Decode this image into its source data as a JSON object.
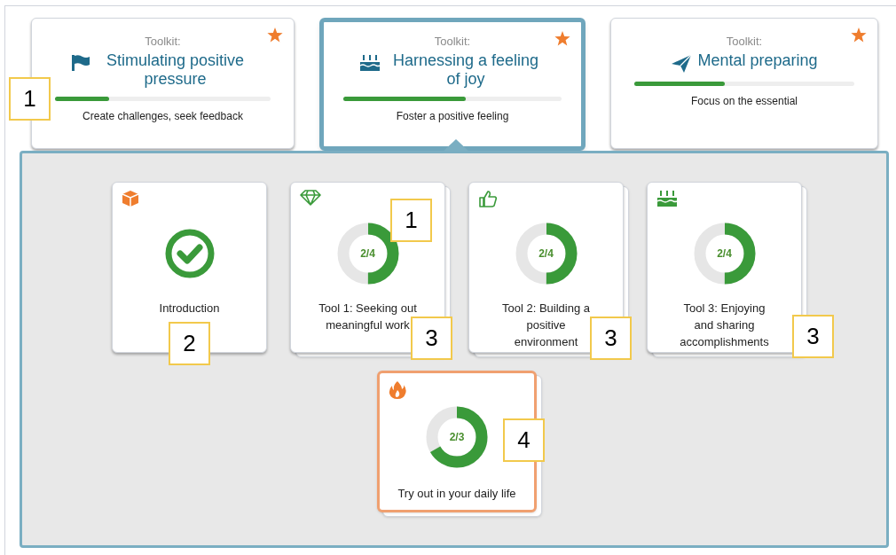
{
  "toolkits": [
    {
      "label": "Toolkit:",
      "title": "Stimulating positive pressure",
      "level": 0.25,
      "description": "Create challenges, seek feedback",
      "selected": false
    },
    {
      "label": "Toolkit:",
      "title": "Harnessing a feeling of joy",
      "level": 0.56,
      "description": "Foster a positive feeling",
      "selected": true
    },
    {
      "label": "Toolkit:",
      "title": "Mental preparing",
      "level": 0.41,
      "description": "Focus on the essential",
      "selected": false
    }
  ],
  "tools": [
    {
      "kind": "complete",
      "title": "Introduction",
      "stacked": false,
      "highlighted": false
    },
    {
      "kind": "progress",
      "title": "Tool 1: Seeking out meaningful work",
      "progress": "2/4",
      "level": 0.5,
      "stacked": true,
      "highlighted": false
    },
    {
      "kind": "progress",
      "title": "Tool 2: Building a positive environment",
      "progress": "2/4",
      "level": 0.5,
      "stacked": true,
      "highlighted": false
    },
    {
      "kind": "progress",
      "title": "Tool 3: Enjoying and sharing accomplishments",
      "progress": "2/4",
      "level": 0.5,
      "stacked": true,
      "highlighted": false
    },
    {
      "kind": "progress",
      "title": "Try out in your daily life",
      "progress": "2/3",
      "level": 0.667,
      "stacked": true,
      "highlighted": true
    }
  ],
  "callouts": [
    {
      "text": "1"
    },
    {
      "text": "1"
    },
    {
      "text": "2"
    },
    {
      "text": "3"
    },
    {
      "text": "3"
    },
    {
      "text": "3"
    },
    {
      "text": "4"
    }
  ]
}
